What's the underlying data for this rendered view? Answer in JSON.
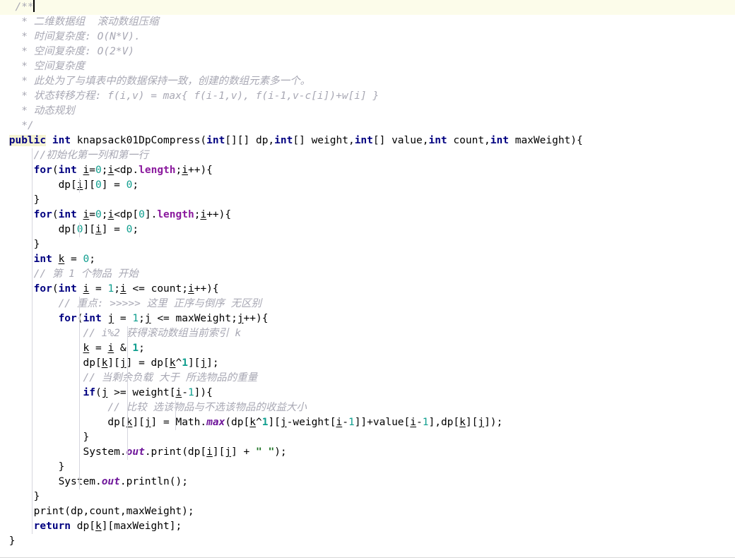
{
  "editor": {
    "language": "java",
    "font_family_hint": "monospace",
    "background": "#ffffff",
    "caret_line_background": "#fcfcea",
    "colors": {
      "comment": "#a8a8b4",
      "keyword": "#000080",
      "number": "#0f9e8e",
      "field": "#8b1a9e",
      "static_field": "#70189b",
      "string": "#1d7324",
      "plain_text": "#000000",
      "indent_guide": "#d6d6de",
      "keyword_highlight": "#f5f3d2"
    }
  },
  "code": {
    "lines": [
      "/**",
      " * 二维数据组  滚动数组压缩",
      " * 时间复杂度: O(N*V).",
      " * 空间复杂度: O(2*V)",
      " * 空间复杂度",
      " * 此处为了与填表中的数据保持一致，创建的数组元素多一个。",
      " * 状态转移方程: f(i,v) = max{ f(i-1,v), f(i-1,v-c[i])+w[i] }",
      " * 动态规划",
      " */",
      "public int knapsack01DpCompress(int[][] dp,int[] weight,int[] value,int count,int maxWeight){",
      "    //初始化第一列和第一行",
      "    for(int i=0;i<dp.length;i++){",
      "        dp[i][0] = 0;",
      "    }",
      "    for(int i=0;i<dp[0].length;i++){",
      "        dp[0][i] = 0;",
      "    }",
      "    int k = 0;",
      "    // 第 1 个物品 开始",
      "    for(int i = 1;i <= count;i++){",
      "        // 重点: >>>>> 这里 正序与倒序 无区别",
      "        for(int j = 1;j <= maxWeight;j++){",
      "            // i%2 获得滚动数组当前索引 k",
      "            k = i & 1;",
      "            dp[k][j] = dp[k^1][j];",
      "            // 当剩余负载 大于 所选物品的重量",
      "            if(j >= weight[i-1]){",
      "                // 比较 选该物品与不选该物品的收益大小",
      "                dp[k][j] = Math.max(dp[k^1][j-weight[i-1]]+value[i-1],dp[k][j]);",
      "            }",
      "            System.out.print(dp[i][j] + \" \");",
      "        }",
      "        System.out.println();",
      "    }",
      "    print(dp,count,maxWeight);",
      "    return dp[k][maxWeight];",
      "}"
    ],
    "method_name": "knapsack01DpCompress",
    "parameters": [
      "int[][] dp",
      "int[] weight",
      "int[] value",
      "int count",
      "int maxWeight"
    ],
    "return_type": "int",
    "modifier": "public",
    "caret_line_index": 0,
    "caret_column": 3
  }
}
